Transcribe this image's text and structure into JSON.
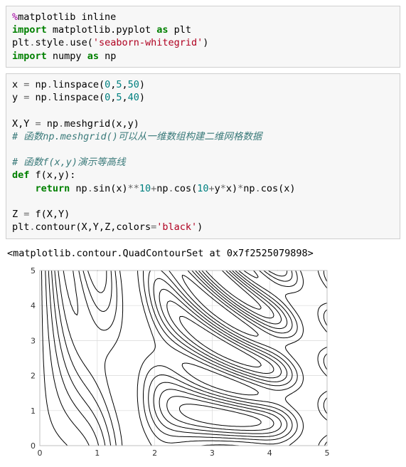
{
  "cell1": {
    "line1": {
      "magic": "%",
      "text": "matplotlib inline"
    },
    "line2": {
      "kw1": "import",
      "mod": " matplotlib.pyplot ",
      "kw2": "as",
      "alias": " plt"
    },
    "line3": {
      "a": "plt",
      "b": ".",
      "c": "style",
      "d": ".",
      "e": "use(",
      "str": "'seaborn-whitegrid'",
      "f": ")"
    },
    "line4": {
      "kw1": "import",
      "mod": " numpy ",
      "kw2": "as",
      "alias": " np"
    }
  },
  "cell2": {
    "l1": {
      "a": "x ",
      "eq": "=",
      "b": " np",
      "c": ".",
      "d": "linspace(",
      "n1": "0",
      "p1": ",",
      "n2": "5",
      "p2": ",",
      "n3": "50",
      "e": ")"
    },
    "l2": {
      "a": "y ",
      "eq": "=",
      "b": " np",
      "c": ".",
      "d": "linspace(",
      "n1": "0",
      "p1": ",",
      "n2": "5",
      "p2": ",",
      "n3": "40",
      "e": ")"
    },
    "l3": "",
    "l4": {
      "a": "X,Y ",
      "eq": "=",
      "b": " np",
      "c": ".",
      "d": "meshgrid(x,y)"
    },
    "l5": "# 函数np.meshgrid()可以从一维数组构建二维网格数据",
    "l6": "",
    "l7": "# 函数f(x,y)演示等高线",
    "l8": {
      "kw": "def",
      "name": " f(x,y):"
    },
    "l9": {
      "indent": "    ",
      "kw": "return",
      "a": " np",
      "b": ".",
      "c": "sin(x)",
      "op1": "**",
      "n1": "10",
      "op2": "+",
      "d": "np",
      "e": ".",
      "f": "cos(",
      "n2": "10",
      "op3": "+",
      "g": "y",
      "op4": "*",
      "h": "x)",
      "op5": "*",
      "i": "np",
      "j": ".",
      "k": "cos(x)"
    },
    "l10": "",
    "l11": {
      "a": "Z ",
      "eq": "=",
      "b": " f(X,Y)"
    },
    "l12": {
      "a": "plt",
      "b": ".",
      "c": "contour(X,Y,Z,colors",
      "eq": "=",
      "str": "'black'",
      "d": ")"
    }
  },
  "output_repr": "<matplotlib.contour.QuadContourSet at 0x7f2525079898>",
  "chart_data": {
    "type": "contour",
    "function": "f(x,y) = sin(x)**10 + cos(10 + y*x) * cos(x)",
    "x_range": [
      0,
      5
    ],
    "y_range": [
      0,
      5
    ],
    "x_points": 50,
    "y_points": 40,
    "colors": "black",
    "linestyles": {
      "positive": "solid",
      "negative": "dashed"
    },
    "xticks": [
      "0",
      "1",
      "2",
      "3",
      "4",
      "5"
    ],
    "yticks": [
      "0",
      "1",
      "2",
      "3",
      "4",
      "5"
    ],
    "title": "",
    "xlabel": "",
    "ylabel": ""
  }
}
